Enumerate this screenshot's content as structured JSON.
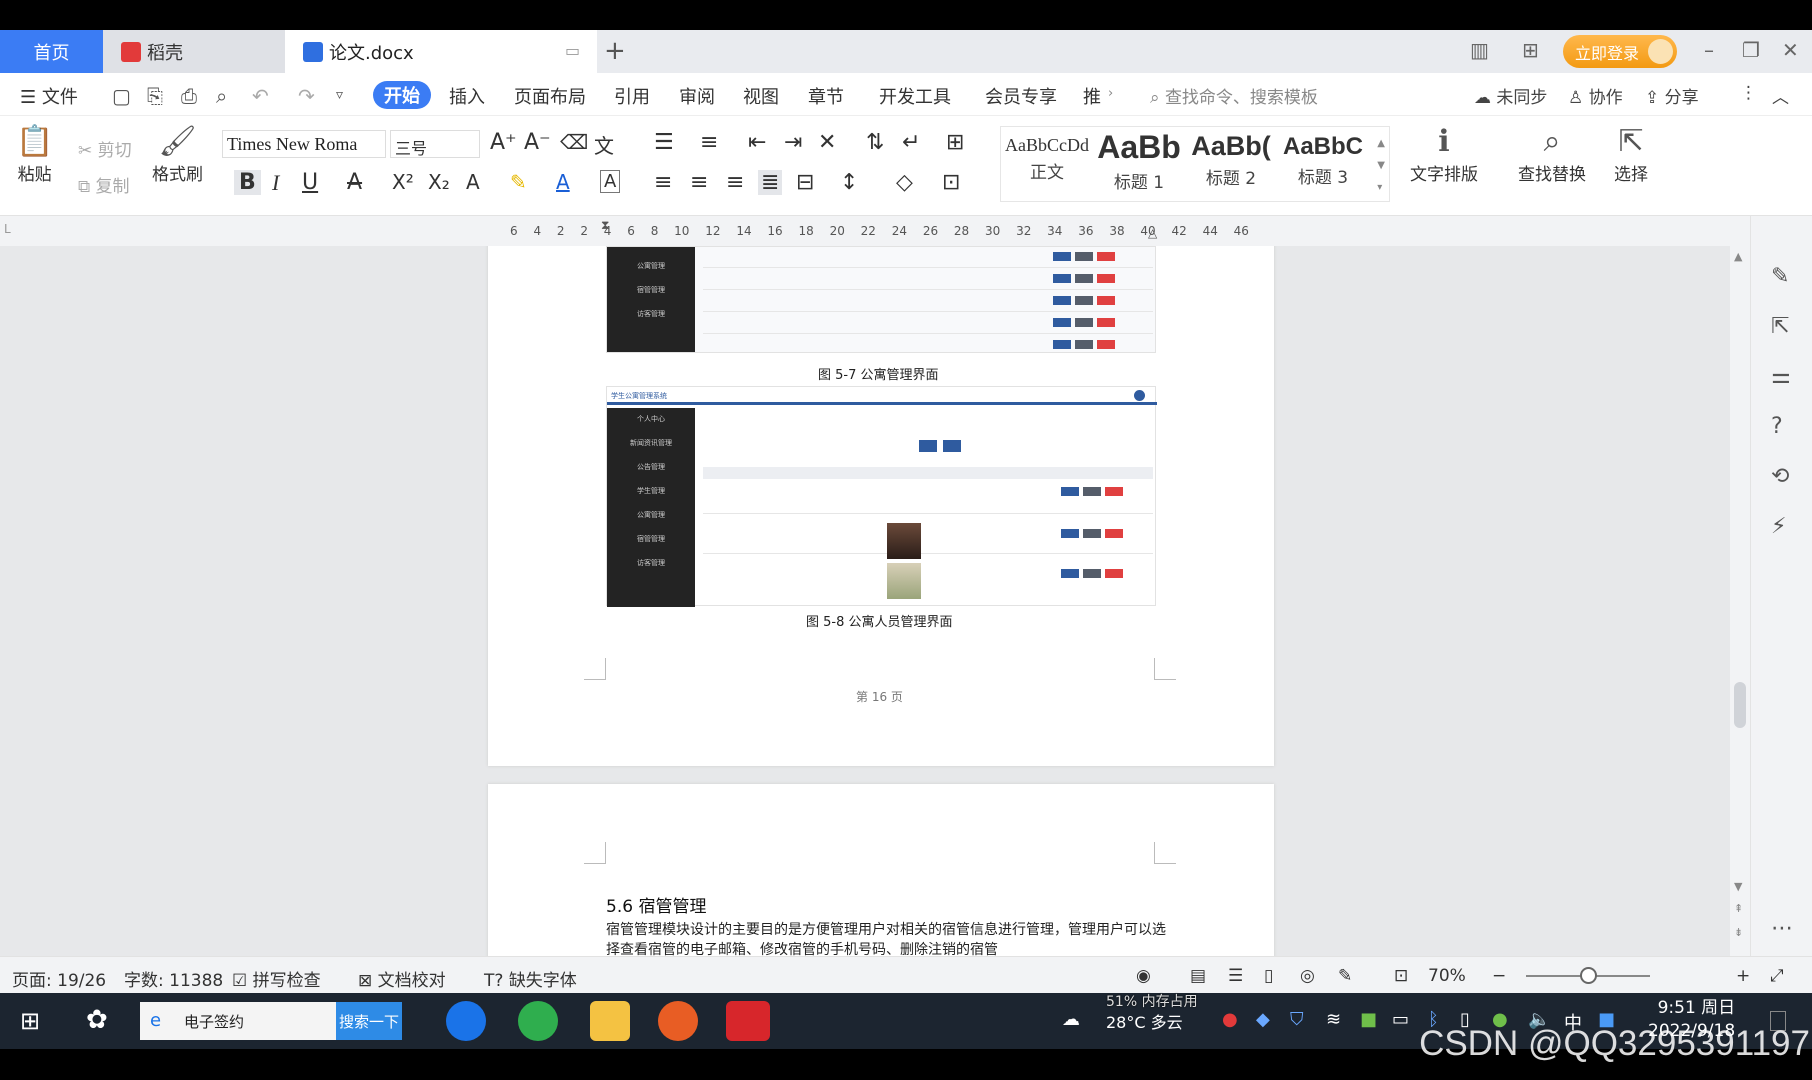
{
  "tabs": {
    "home": "首页",
    "docer": "稻壳",
    "doc": "论文.docx",
    "new_tab": "+",
    "login": "立即登录"
  },
  "menu": {
    "file": "文件",
    "items": [
      "开始",
      "插入",
      "页面布局",
      "引用",
      "审阅",
      "视图",
      "章节",
      "开发工具",
      "会员专享",
      "推"
    ],
    "search_placeholder": "查找命令、搜索模板",
    "unsynced": "未同步",
    "collab": "协作",
    "share": "分享"
  },
  "ribbon": {
    "paste": "粘贴",
    "cut": "剪切",
    "copy": "复制",
    "format_painter": "格式刷",
    "font_name": "Times New Roma",
    "font_size": "三号",
    "styles": [
      {
        "sample": "AaBbCcDd",
        "name": "正文"
      },
      {
        "sample": "AaBb",
        "name": "标题 1"
      },
      {
        "sample": "AaBb(",
        "name": "标题 2"
      },
      {
        "sample": "AaBbC",
        "name": "标题 3"
      }
    ],
    "text_layout": "文字排版",
    "find_replace": "查找替换",
    "select": "选择"
  },
  "ruler": {
    "numbers": "6 4 2 2 4 6 8 10 12 14 16 18 20 22 24 26 28 30 32 34 36 38 40 42 44 46"
  },
  "document": {
    "fig1_caption": "图 5-7 公寓管理界面",
    "fig2_caption": "图 5-8 公寓人员管理界面",
    "fig2_title": "学生公寓管理系统",
    "fig1_side": [
      "公寓管理",
      "宿管管理",
      "访客管理"
    ],
    "fig2_side": [
      "个人中心",
      "新闻资讯管理",
      "公告管理",
      "学生管理",
      "公寓管理",
      "宿管管理",
      "访客管理"
    ],
    "page_number": "第 16 页",
    "heading": "5.6 宿管管理",
    "paragraph": "宿管管理模块设计的主要目的是方便管理用户对相关的宿管信息进行管理，管理用户可以选择查看宿管的电子邮箱、修改宿管的手机号码、删除注销的宿管"
  },
  "status": {
    "page": "页面: 19/26",
    "words": "字数: 11388",
    "spell": "拼写检查",
    "proof": "文档校对",
    "missing_font": "缺失字体",
    "zoom": "70%"
  },
  "taskbar": {
    "search_text": "电子签约",
    "search_button": "搜索一下",
    "weather": "28°C 多云",
    "memory": "51% 内存占用",
    "ime": "中",
    "time": "9:51 周日",
    "date": "2022/9/18"
  },
  "watermark": "CSDN @QQ3295391197",
  "colors": {
    "accent": "#3b7cf4",
    "login": "#f39a12",
    "taskbar": "#1c2530"
  }
}
